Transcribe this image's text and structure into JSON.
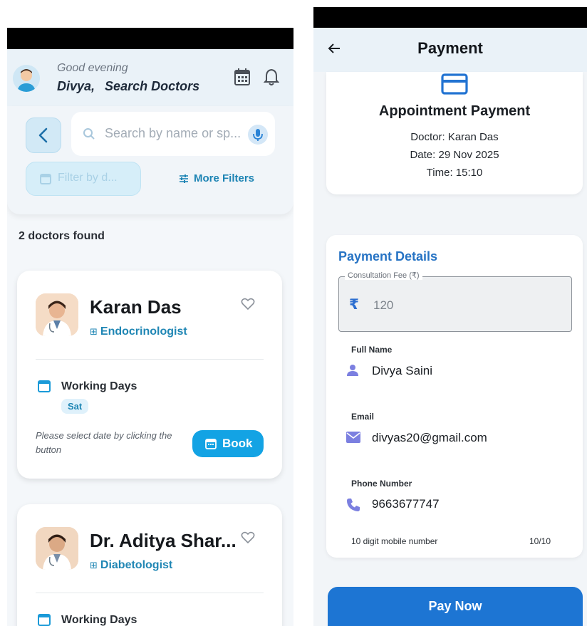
{
  "left": {
    "header": {
      "greeting": "Good evening",
      "user_name": "Divya,",
      "screen_title": "Search Doctors"
    },
    "search": {
      "placeholder": "Search by name or sp...",
      "date_filter_label": "Filter by d...",
      "more_filters_label": "More Filters"
    },
    "results_count": "2 doctors found",
    "doctors": [
      {
        "name": "Karan Das",
        "specialty": "Endocrinologist",
        "working_days_label": "Working Days",
        "days": [
          "Sat"
        ],
        "note": "Please select date by clicking the button",
        "book_label": "Book"
      },
      {
        "name": "Dr. Aditya Shar...",
        "specialty": "Diabetologist",
        "working_days_label": "Working Days"
      }
    ]
  },
  "right": {
    "header": {
      "title": "Payment"
    },
    "summary": {
      "title": "Appointment Payment",
      "doctor": "Doctor: Karan Das",
      "date": "Date: 29 Nov 2025",
      "time": "Time: 15:10"
    },
    "details": {
      "title": "Payment Details",
      "fee_label": "Consultation Fee (₹)",
      "fee_symbol": "₹",
      "fee_value": "120",
      "full_name_label": "Full Name",
      "full_name_value": "Divya Saini",
      "email_label": "Email",
      "email_value": "divyas20@gmail.com",
      "phone_label": "Phone Number",
      "phone_value": "9663677747",
      "phone_helper": "10 digit mobile number",
      "phone_counter": "10/10"
    },
    "pay_label": "Pay Now"
  },
  "colors": {
    "accent_blue": "#1d75d3",
    "accent_cyan": "#13a3e4",
    "specialty_text": "#1f86b4",
    "icon_purple": "#7b7fe0"
  }
}
